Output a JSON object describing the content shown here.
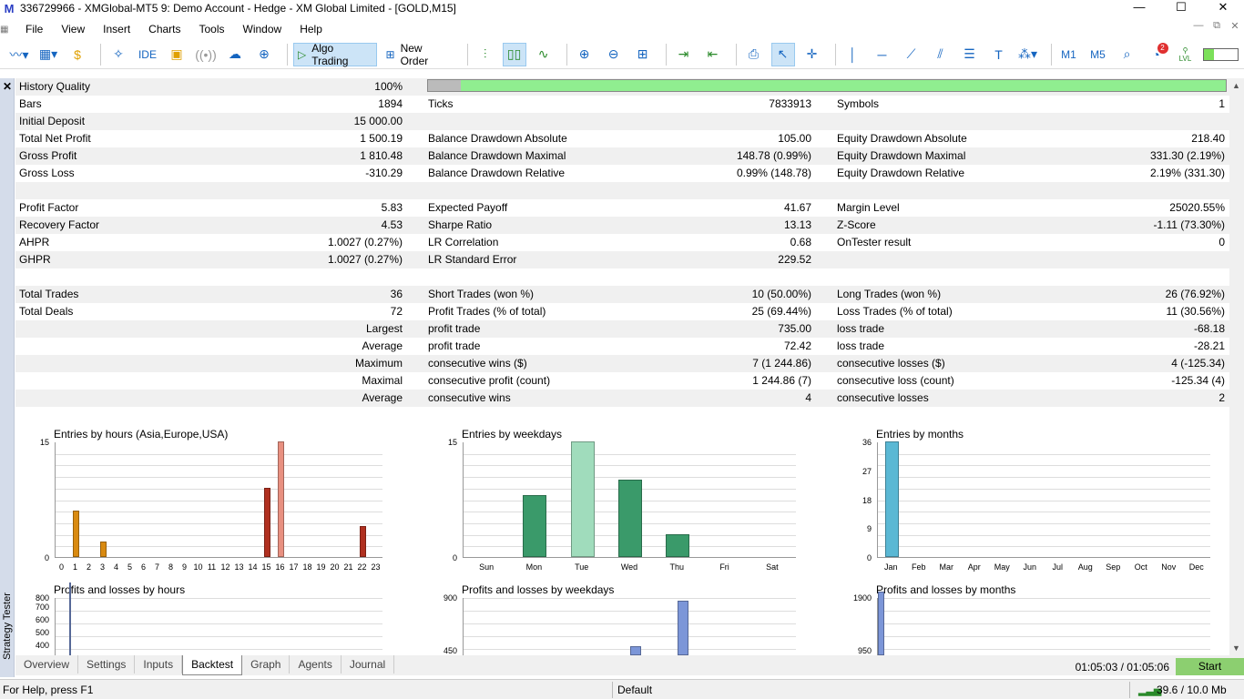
{
  "window": {
    "title": "336729966 - XMGlobal-MT5 9: Demo Account - Hedge - XM Global Limited - [GOLD,M15]",
    "min": "—",
    "max": "☐",
    "close": "✕"
  },
  "menu": [
    "File",
    "View",
    "Insert",
    "Charts",
    "Tools",
    "Window",
    "Help"
  ],
  "toolbar": {
    "algo_trading": "Algo Trading",
    "new_order": "New Order",
    "ide": "IDE",
    "tf1": "M1",
    "tf2": "M5",
    "notif_count": "2",
    "lvl": "LVL"
  },
  "panel": {
    "close": "✕",
    "vertical_label": "Strategy Tester"
  },
  "stats": [
    {
      "y": 0,
      "alt": true,
      "l1": "History Quality",
      "v1": "100%",
      "qbar": true
    },
    {
      "y": 19,
      "l1": "Bars",
      "v1": "1894",
      "l2": "Ticks",
      "v2": "7833913",
      "l3": "Symbols",
      "v3": "1"
    },
    {
      "y": 38,
      "alt": true,
      "l1": "Initial Deposit",
      "v1": "15 000.00"
    },
    {
      "y": 57,
      "l1": "Total Net Profit",
      "v1": "1 500.19",
      "l2": "Balance Drawdown Absolute",
      "v2": "105.00",
      "l3": "Equity Drawdown Absolute",
      "v3": "218.40"
    },
    {
      "y": 76,
      "alt": true,
      "l1": "Gross Profit",
      "v1": "1 810.48",
      "l2": "Balance Drawdown Maximal",
      "v2": "148.78 (0.99%)",
      "l3": "Equity Drawdown Maximal",
      "v3": "331.30 (2.19%)"
    },
    {
      "y": 95,
      "l1": "Gross Loss",
      "v1": "-310.29",
      "l2": "Balance Drawdown Relative",
      "v2": "0.99% (148.78)",
      "l3": "Equity Drawdown Relative",
      "v3": "2.19% (331.30)"
    },
    {
      "y": 114,
      "alt": true
    },
    {
      "y": 133,
      "l1": "Profit Factor",
      "v1": "5.83",
      "l2": "Expected Payoff",
      "v2": "41.67",
      "l3": "Margin Level",
      "v3": "25020.55%"
    },
    {
      "y": 152,
      "alt": true,
      "l1": "Recovery Factor",
      "v1": "4.53",
      "l2": "Sharpe Ratio",
      "v2": "13.13",
      "l3": "Z-Score",
      "v3": "-1.11 (73.30%)"
    },
    {
      "y": 171,
      "l1": "AHPR",
      "v1": "1.0027 (0.27%)",
      "l2": "LR Correlation",
      "v2": "0.68",
      "l3": "OnTester result",
      "v3": "0"
    },
    {
      "y": 190,
      "alt": true,
      "l1": "GHPR",
      "v1": "1.0027 (0.27%)",
      "l2": "LR Standard Error",
      "v2": "229.52"
    },
    {
      "y": 209
    },
    {
      "y": 228,
      "alt": true,
      "l1": "Total Trades",
      "v1": "36",
      "l2": "Short Trades (won %)",
      "v2": "10 (50.00%)",
      "l3": "Long Trades (won %)",
      "v3": "26 (76.92%)"
    },
    {
      "y": 247,
      "l1": "Total Deals",
      "v1": "72",
      "l2": "Profit Trades (% of total)",
      "v2": "25 (69.44%)",
      "l3": "Loss Trades (% of total)",
      "v3": "11 (30.56%)"
    },
    {
      "y": 266,
      "alt": true,
      "v1": "Largest",
      "l2": "profit trade",
      "v2": "735.00",
      "l3": "loss trade",
      "v3": "-68.18"
    },
    {
      "y": 285,
      "v1": "Average",
      "l2": "profit trade",
      "v2": "72.42",
      "l3": "loss trade",
      "v3": "-28.21"
    },
    {
      "y": 304,
      "alt": true,
      "v1": "Maximum",
      "l2": "consecutive wins ($)",
      "v2": "7 (1 244.86)",
      "l3": "consecutive losses ($)",
      "v3": "4 (-125.34)"
    },
    {
      "y": 323,
      "v1": "Maximal",
      "l2": "consecutive profit (count)",
      "v2": "1 244.86 (7)",
      "l3": "consecutive loss (count)",
      "v3": "-125.34 (4)"
    },
    {
      "y": 342,
      "alt": true,
      "v1": "Average",
      "l2": "consecutive wins",
      "v2": "4",
      "l3": "consecutive losses",
      "v3": "2"
    },
    {
      "y": 361
    }
  ],
  "chart_data": [
    {
      "type": "bar",
      "title": "Entries by hours (Asia,Europe,USA)",
      "categories": [
        "0",
        "1",
        "2",
        "3",
        "4",
        "5",
        "6",
        "7",
        "8",
        "9",
        "10",
        "11",
        "12",
        "13",
        "14",
        "15",
        "16",
        "17",
        "18",
        "19",
        "20",
        "21",
        "22",
        "23"
      ],
      "values": [
        0,
        6,
        0,
        2,
        0,
        0,
        0,
        0,
        0,
        0,
        0,
        0,
        0,
        0,
        0,
        9,
        15,
        0,
        0,
        0,
        0,
        0,
        4,
        0
      ],
      "ylim": [
        0,
        15
      ],
      "yticks": [
        "15",
        "0"
      ],
      "colors": [
        "#d98a10",
        "#d98a10",
        "#d98a10",
        "#d98a10",
        "#d98a10",
        "#d98a10",
        "#d98a10",
        "#d98a10",
        "#c07020",
        "#c07020",
        "#c07020",
        "#c07020",
        "#c07020",
        "#c07020",
        "#c07020",
        "#b03020",
        "#e89080",
        "#b03020",
        "#b03020",
        "#b03020",
        "#b03020",
        "#b03020",
        "#b03020",
        "#b03020"
      ]
    },
    {
      "type": "bar",
      "title": "Entries by weekdays",
      "categories": [
        "Sun",
        "Mon",
        "Tue",
        "Wed",
        "Thu",
        "Fri",
        "Sat"
      ],
      "values": [
        0,
        8,
        15,
        10,
        3,
        0,
        0
      ],
      "ylim": [
        0,
        15
      ],
      "yticks": [
        "15",
        "0"
      ],
      "colors": [
        "#3a9a6a",
        "#3a9a6a",
        "#a0dcbc",
        "#3a9a6a",
        "#3a9a6a",
        "#3a9a6a",
        "#3a9a6a"
      ]
    },
    {
      "type": "bar",
      "title": "Entries by months",
      "categories": [
        "Jan",
        "Feb",
        "Mar",
        "Apr",
        "May",
        "Jun",
        "Jul",
        "Aug",
        "Sep",
        "Oct",
        "Nov",
        "Dec"
      ],
      "values": [
        36,
        0,
        0,
        0,
        0,
        0,
        0,
        0,
        0,
        0,
        0,
        0
      ],
      "ylim": [
        0,
        36
      ],
      "yticks": [
        "36",
        "27",
        "18",
        "9",
        "0"
      ],
      "colors": [
        "#5ab8d4",
        "#5ab8d4",
        "#5ab8d4",
        "#5ab8d4",
        "#5ab8d4",
        "#5ab8d4",
        "#5ab8d4",
        "#5ab8d4",
        "#5ab8d4",
        "#5ab8d4",
        "#5ab8d4",
        "#5ab8d4"
      ]
    }
  ],
  "lower_charts": [
    {
      "title": "Profits and losses by hours",
      "yticks": [
        "800",
        "700",
        "600",
        "500",
        "400"
      ]
    },
    {
      "title": "Profits and losses by weekdays",
      "yticks": [
        "900",
        "450"
      ]
    },
    {
      "title": "Profits and losses by months",
      "yticks": [
        "1900",
        "950"
      ]
    }
  ],
  "tabs": [
    "Overview",
    "Settings",
    "Inputs",
    "Backtest",
    "Graph",
    "Agents",
    "Journal"
  ],
  "active_tab": "Backtest",
  "tester": {
    "time": "01:05:03 / 01:05:06",
    "start": "Start"
  },
  "status": {
    "help": "For Help, press F1",
    "profile": "Default",
    "traffic": "39.6 / 10.0 Mb"
  }
}
